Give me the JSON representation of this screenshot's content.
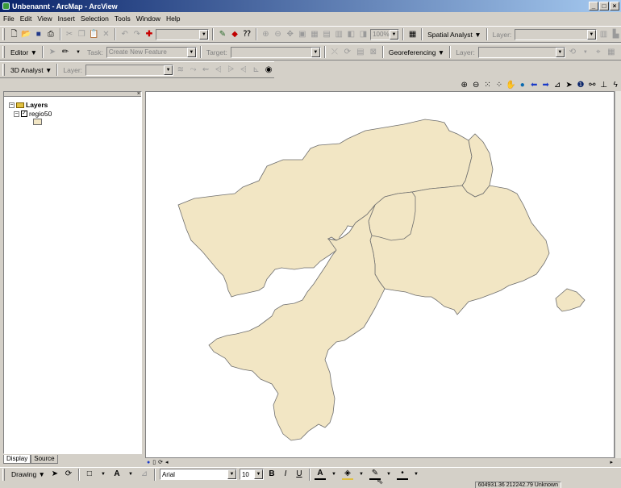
{
  "window": {
    "title": "Unbenannt - ArcMap - ArcView",
    "min": "_",
    "max": "□",
    "close": "×"
  },
  "menu": [
    "File",
    "Edit",
    "View",
    "Insert",
    "Selection",
    "Tools",
    "Window",
    "Help"
  ],
  "standard_toolbar": {
    "scale_value": "",
    "zoom_percent": "100%",
    "spatial_analyst": "Spatial Analyst ▼",
    "layer_label": "Layer:"
  },
  "editor_toolbar": {
    "editor": "Editor ▼",
    "task_label": "Task:",
    "task_value": "Create New Feature",
    "target_label": "Target:",
    "georef": "Georeferencing ▼",
    "layer_label": "Layer:"
  },
  "analyst3d_toolbar": {
    "label": "3D Analyst ▼",
    "layer_label": "Layer:"
  },
  "toc": {
    "root": "Layers",
    "layer": "regio50",
    "tabs": [
      "Display",
      "Source"
    ]
  },
  "map": {
    "fill": "#f2e6c4",
    "stroke": "#6e6e6e"
  },
  "drawing_toolbar": {
    "drawing": "Drawing ▼",
    "font": "Arial",
    "size": "10",
    "bold": "B",
    "italic": "I",
    "underline": "U"
  },
  "status": {
    "coords": "604931.36 212242.79 Unknown"
  },
  "colors": {
    "titlebar_start": "#0a246a",
    "chrome": "#d4d0c8"
  }
}
